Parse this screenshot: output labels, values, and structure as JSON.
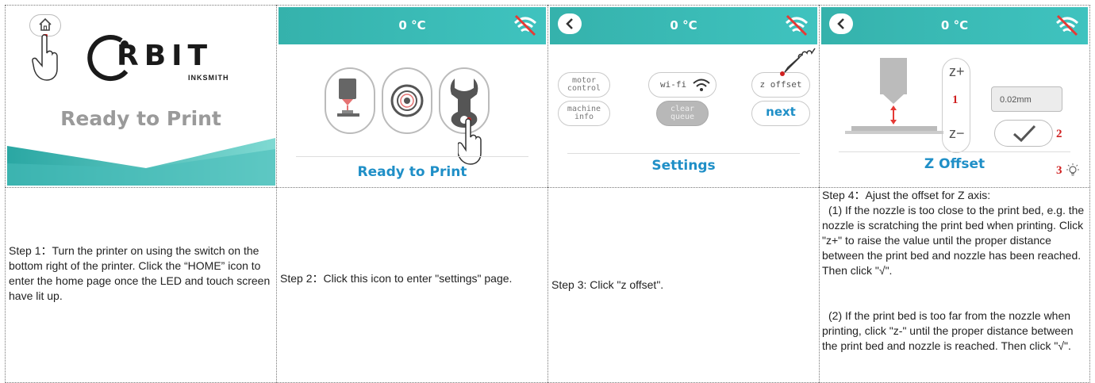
{
  "panel1": {
    "logo_text": "RBIT",
    "logo_sub": "INKSMITH",
    "title": "Ready to Print"
  },
  "panel2": {
    "temp": "0 °C",
    "footer": "Ready to Print"
  },
  "panel3": {
    "temp": "0 °C",
    "buttons": {
      "motor": "motor\ncontrol",
      "machine": "machine\ninfo",
      "wifi": "wi-fi",
      "clear": "clear\nqueue",
      "zoffset": "z offset",
      "next": "next"
    },
    "footer": "Settings"
  },
  "panel4": {
    "temp": "0 °C",
    "z_plus": "z+",
    "z_minus": "z−",
    "marker1": "1",
    "marker2": "2",
    "marker3": "3",
    "value": "0.02mm",
    "footer": "Z Offset"
  },
  "steps": {
    "step1": "Step 1：Turn the printer on using the switch on the bottom right of the printer. Click the “HOME” icon to enter the home page once the LED and touch screen have lit up.",
    "step2": "Step 2：Click this icon to enter \"settings\" page.",
    "step3": "Step 3: Click \"z offset\".",
    "step4_title": "Step 4：Ajust the offset for Z axis:",
    "step4_p1": "(1) If the nozzle is too close to the print bed, e.g. the nozzle is scratching the print bed when printing. Click \"z+\" to raise the value until the proper distance between the print bed and nozzle has been reached. Then click \"√\".",
    "step4_p2": "(2) If the print bed is too far from the nozzle when printing, click \"z-\" until the proper distance between the print bed and nozzle is reached. Then click \"√\"."
  },
  "colors": {
    "accent": "#3bbdb8",
    "footer_text": "#1f8fc7",
    "marker_red": "#d02020"
  }
}
